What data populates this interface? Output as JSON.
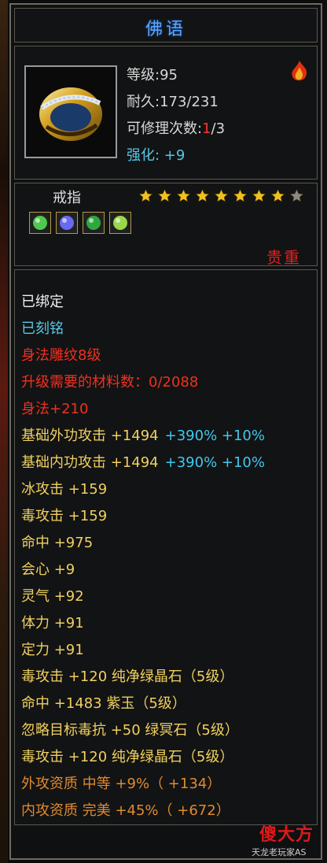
{
  "item": {
    "name": "佛语",
    "level_label": "等级:95",
    "durability_label": "耐久:173/231",
    "repair_prefix": "可修理次数:",
    "repair_current": "1",
    "repair_suffix": "/3",
    "strength_label": "强化: +9",
    "type": "戒指",
    "stars_filled": 8,
    "stars_total": 9,
    "value": "贵重",
    "gems": [
      {
        "name": "green-gem-icon",
        "color": "#4ec84e"
      },
      {
        "name": "blue-gem-icon",
        "color": "#6a6af0"
      },
      {
        "name": "emerald-gem-icon",
        "color": "#2ea83e"
      },
      {
        "name": "jade-gem-icon",
        "color": "#9ad84a"
      }
    ]
  },
  "attributes": [
    {
      "text": "已绑定",
      "color": "white"
    },
    {
      "text": "已刻铭",
      "color": "blue"
    },
    {
      "text": "身法雕纹8级",
      "color": "red"
    },
    {
      "text": "升级需要的材料数：0/2088",
      "color": "red"
    },
    {
      "text": "身法+210",
      "color": "red"
    },
    {
      "text": "基础外功攻击 +1494",
      "extra": "+390% +10%",
      "color": "gold"
    },
    {
      "text": "基础内功攻击 +1494",
      "extra": "+390% +10%",
      "color": "gold"
    },
    {
      "text": "冰攻击 +159",
      "color": "gold"
    },
    {
      "text": "毒攻击 +159",
      "color": "gold"
    },
    {
      "text": "命中 +975",
      "color": "gold"
    },
    {
      "text": "会心 +9",
      "color": "gold"
    },
    {
      "text": "灵气 +92",
      "color": "gold"
    },
    {
      "text": "体力 +91",
      "color": "gold"
    },
    {
      "text": "定力 +91",
      "color": "gold"
    },
    {
      "text": "毒攻击 +120 纯净绿晶石（5级）",
      "color": "gold"
    },
    {
      "text": "命中 +1483 紫玉（5级）",
      "color": "gold"
    },
    {
      "text": "忽略目标毒抗 +50 绿冥石（5级）",
      "color": "gold"
    },
    {
      "text": "毒攻击 +120 纯净绿晶石（5级）",
      "color": "gold"
    },
    {
      "text": "外攻资质 中等 +9%（ +134）",
      "color": "orange"
    },
    {
      "text": "内攻资质 完美 +45%（ +672）",
      "color": "orange"
    }
  ],
  "watermark": {
    "main": "傻大方",
    "sub": "天龙老玩家AS"
  },
  "colors": {
    "title": "#5aa6ff",
    "value": "#e02020",
    "star": "#f0c020",
    "star_empty": "#8a8a8a"
  }
}
